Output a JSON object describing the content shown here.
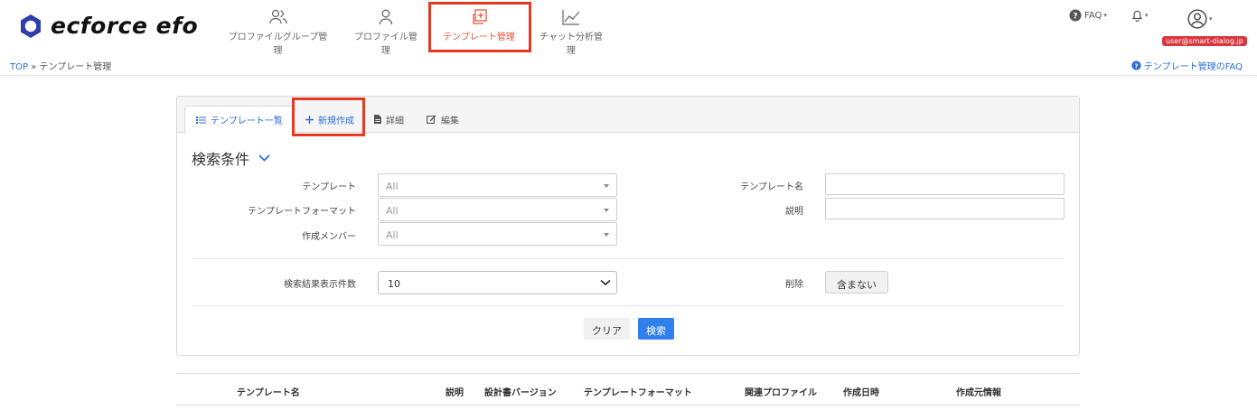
{
  "app": {
    "logo_text": "ecforce efo",
    "brand_color": "#2f3ea8",
    "accent": "#e8543a"
  },
  "nav": {
    "items": [
      {
        "label": "プロファイルグループ管理",
        "icon": "users-icon"
      },
      {
        "label": "プロファイル管理",
        "icon": "user-icon"
      },
      {
        "label": "テンプレート管理",
        "icon": "template-add-icon",
        "active": true
      },
      {
        "label": "チャット分析管理",
        "icon": "chart-line-icon"
      }
    ],
    "faq_label": "FAQ",
    "user_email": "user@smart-dialog.jp"
  },
  "breadcrumb": {
    "root": "TOP",
    "separator": "»",
    "current": "テンプレート管理"
  },
  "faq_link": "テンプレート管理のFAQ",
  "tabs": [
    {
      "label": "テンプレート一覧",
      "icon": "list-icon",
      "active": true
    },
    {
      "label": "新規作成",
      "icon": "plus-icon"
    },
    {
      "label": "詳細",
      "icon": "document-icon"
    },
    {
      "label": "編集",
      "icon": "edit-icon"
    }
  ],
  "search": {
    "title": "検索条件",
    "template_label": "テンプレート",
    "template_value": "All",
    "format_label": "テンプレートフォーマット",
    "format_value": "All",
    "member_label": "作成メンバー",
    "member_value": "All",
    "name_label": "テンプレート名",
    "name_value": "",
    "desc_label": "説明",
    "desc_value": "",
    "count_label": "検索結果表示件数",
    "count_value": "10",
    "delete_label": "削除",
    "delete_value": "含まない",
    "clear_button": "クリア",
    "search_button": "検索"
  },
  "table": {
    "columns": [
      "テンプレート名",
      "説明",
      "設計書バージョン",
      "テンプレートフォーマット",
      "関連プロファイル",
      "作成日時",
      "作成元情報"
    ]
  }
}
